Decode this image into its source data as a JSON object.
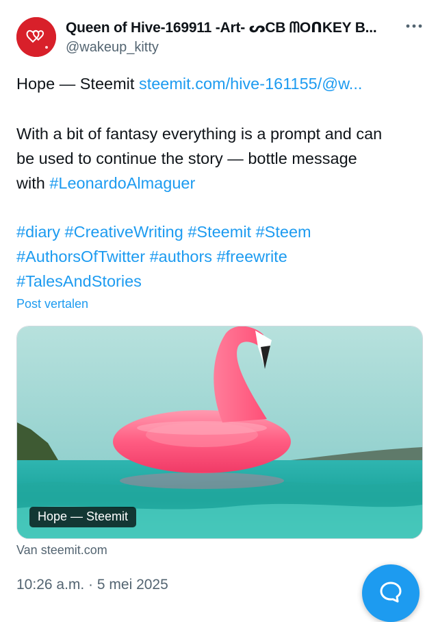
{
  "author": {
    "display_name": "Queen of Hive-169911 -Art- ᔕCB ᗰOᑎKEY B...",
    "handle": "@wakeup_kitty",
    "avatar_icon": "red-hearts-avatar",
    "more_icon": "more-icon"
  },
  "post": {
    "title_text": "Hope — Steemit ",
    "title_link": "steemit.com/hive-161155/@w...",
    "body_line1": "With a bit of fantasy everything is a prompt and can",
    "body_line2": "be used to continue the story — bottle message",
    "body_line3_prefix": "with ",
    "body_mention_tag": "#LeonardoAlmaguer",
    "hashtags_line1": "#diary #CreativeWriting #Steemit #Steem",
    "hashtags_line2": "#AuthorsOfTwitter #authors #freewrite",
    "hashtags_line3": "#TalesAndStories",
    "translate_label": "Post vertalen"
  },
  "link_card": {
    "badge_label": "Hope — Steemit",
    "image_subject": "pink flamingo float on turquoise sea",
    "source_label": "Van steemit.com"
  },
  "timestamp": "10:26 a.m. · 5 mei 2025",
  "compose_button": {
    "icon": "reply-bubble-icon"
  },
  "colors": {
    "link": "#1d9bf0",
    "secondary_text": "#536471",
    "avatar_bg": "#d8202a"
  }
}
